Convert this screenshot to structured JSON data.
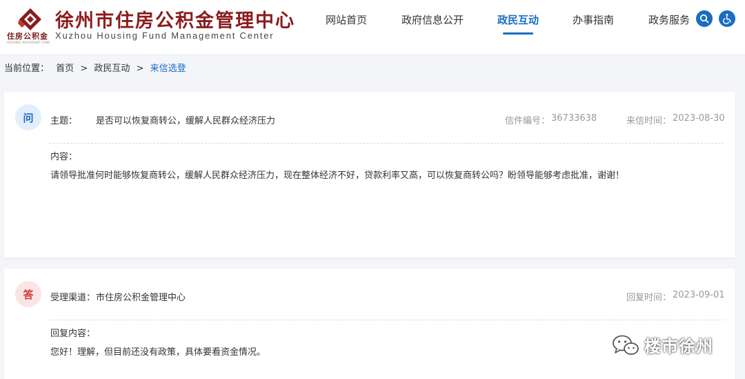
{
  "header": {
    "logo_name_cn": "住房公积金",
    "logo_name_en": "HOUSING PROVIDENT FUND",
    "title_cn": "徐州市住房公积金管理中心",
    "title_en": "Xuzhou Housing Fund Management Center",
    "brand_color": "#8b1c1c",
    "accent_color": "#1a6dc2"
  },
  "nav": {
    "items": [
      {
        "label": "网站首页"
      },
      {
        "label": "政府信息公开"
      },
      {
        "label": "政民互动"
      },
      {
        "label": "办事指南"
      },
      {
        "label": "政务服务"
      }
    ],
    "active_index": 2,
    "search_icon": "search-icon",
    "accessibility_icon": "wheelchair-icon"
  },
  "breadcrumb": {
    "prefix": "当前位置：",
    "items": [
      "首页",
      "政民互动",
      "来信选登"
    ],
    "separator": ">"
  },
  "question": {
    "badge": "问",
    "subject_label": "主题：",
    "subject": "是否可以恢复商转公，缓解人民群众经济压力",
    "letter_no_label": "信件编号：",
    "letter_no": "36733638",
    "date_label": "来信时间：",
    "date": "2023-08-30",
    "content_label": "内容：",
    "content": "请领导批准何时能够恢复商转公，缓解人民群众经济压力，现在整体经济不好，贷款利率又高，可以恢复商转公吗？盼领导能够考虑批准，谢谢！"
  },
  "answer": {
    "badge": "答",
    "channel_label": "受理渠道：",
    "channel": "市住房公积金管理中心",
    "date_label": "回复时间：",
    "date": "2023-09-01",
    "content_label": "回复内容：",
    "content": "您好！理解，但目前还没有政策，具体要看资金情况。"
  },
  "watermark": {
    "text": "楼市徐州",
    "icon": "wechat-icon"
  }
}
